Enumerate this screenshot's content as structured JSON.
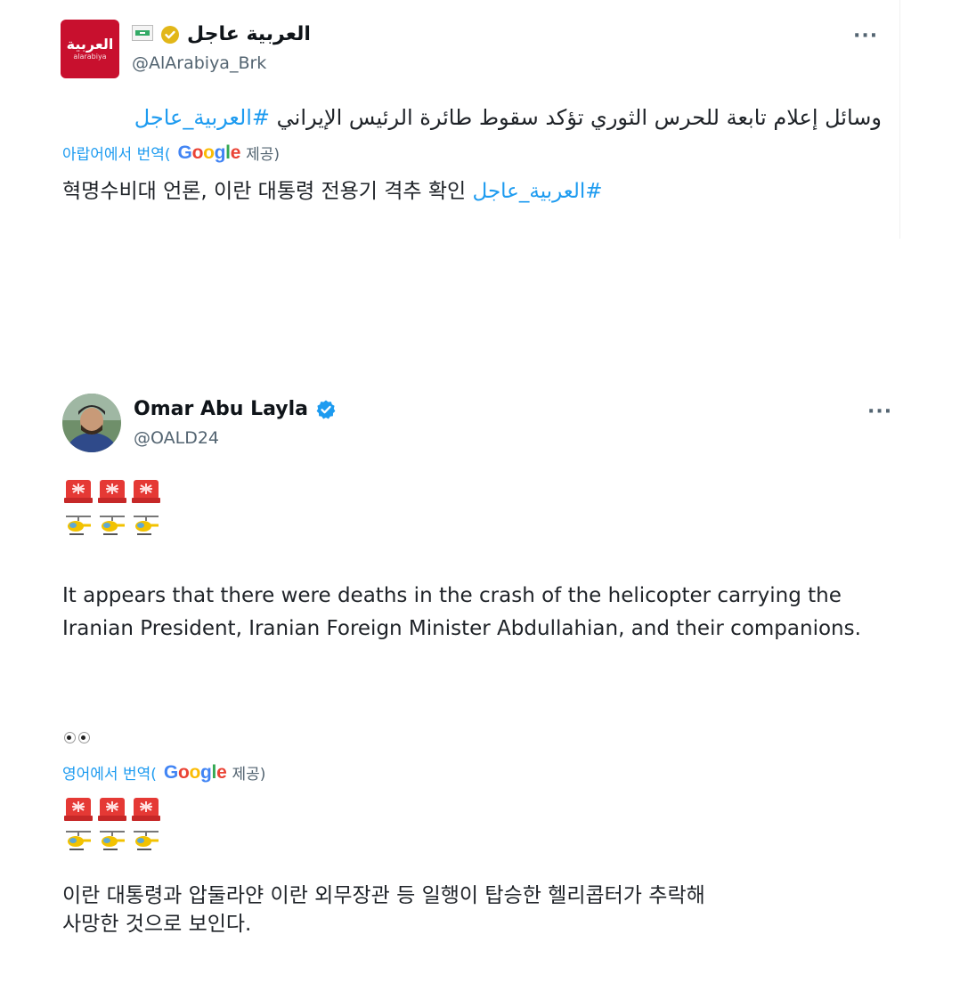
{
  "tweet1": {
    "avatar_text": "العربية",
    "avatar_subtext": "alarabiya",
    "display_name": "العربية عاجل",
    "handle": "@AlArabiya_Brk",
    "more": "···",
    "text_ar": "وسائل إعلام تابعة للحرس الثوري تؤكد سقوط طائرة الرئيس الإيراني",
    "hashtag_ar": "#العربية_عاجل",
    "translate_label": "아랍어에서 번역(",
    "translate_google": "Google",
    "translate_suffix": "제공)",
    "text_ko": "혁명수비대 언론, 이란 대통령 전용기 격추 확인",
    "hashtag_ko": "#العربية_عاجل"
  },
  "tweet2": {
    "display_name": "Omar Abu Layla",
    "handle": "@OALD24",
    "more": "···",
    "text_en": "It appears that there were deaths in the crash of the helicopter carrying the Iranian President, Iranian Foreign Minister Abdullahian, and their companions.",
    "translate_label": "영어에서 번역(",
    "translate_google": "Google",
    "translate_suffix": "제공)",
    "text_ko_line1": "이란 대통령과 압둘라얀 이란 외무장관 등 일행이 탑승한 헬리콥터가 추락해",
    "text_ko_line2": "사망한 것으로 보인다."
  },
  "colors": {
    "link": "#1d9bf0",
    "verified_blue": "#1d9bf0",
    "verified_gold": "#e2b719",
    "alarabiya_red": "#c8102e"
  },
  "icons": [
    "verified-badge-icon",
    "flag-icon",
    "more-icon",
    "siren-emoji",
    "helicopter-emoji",
    "eyes-emoji"
  ]
}
